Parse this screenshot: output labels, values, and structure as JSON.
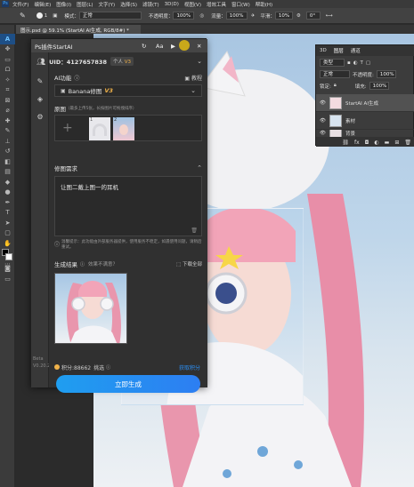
{
  "menubar": [
    "文件(F)",
    "编辑(E)",
    "图像(I)",
    "图层(L)",
    "文字(Y)",
    "选择(S)",
    "滤镜(T)",
    "3D(D)",
    "视图(V)",
    "增效工具",
    "窗口(W)",
    "帮助(H)"
  ],
  "options": {
    "mode_label": "模式：",
    "mode_value": "正常",
    "opacity_label": "不透明度：",
    "opacity_value": "100%",
    "flow_label": "流量：",
    "flow_value": "100%",
    "smooth_label": "平滑：",
    "smooth_value": "10%",
    "angle_value": "0°",
    "size_value": "1"
  },
  "document_tab": "图示.psd @ 59.1% (StartAI AI生成, RGB/8#) *",
  "plugin": {
    "title": "Ps插件StartAI",
    "uid_label": "UID：4127657838",
    "account_type": "个人",
    "vip_badge": "V3",
    "ai_function_label": "AI功能",
    "tutorial_label": "教程",
    "model_name": "Banana修图",
    "model_version": "V3",
    "source_label": "原图",
    "source_hint": "（最多上传5张，长按图片可拖拽排序）",
    "thumb_numbers": [
      "1",
      "2"
    ],
    "requirement_label": "修图需求",
    "prompt_text": "让图二戴上图一的耳机",
    "notice_text": "温馨提示：此功能由外部服务器提供，使用服务不稳定，如遇使用问题，请稍后重试。",
    "result_label": "生成结果",
    "result_question": "效果不满意？",
    "download_all": "下载全部",
    "points_label": "积分:88662",
    "points_suffix": "挑选",
    "get_points": "获取积分",
    "generate_button": "立即生成",
    "version_label": "Beta",
    "version_number": "V0.20.2"
  },
  "layers_panel": {
    "tabs": [
      "3D",
      "图层",
      "通道"
    ],
    "kind_label": "类型",
    "blend_mode": "正常",
    "opacity_label": "不透明度:",
    "opacity_value": "100%",
    "lock_label": "锁定:",
    "fill_label": "填充:",
    "fill_value": "100%",
    "layers": [
      "StartAI AI生成",
      "素材",
      "背景"
    ]
  },
  "colors": {
    "accent": "#2b8ef2",
    "panel_bg": "#303030",
    "yellow_dot": "#c8a81a"
  }
}
